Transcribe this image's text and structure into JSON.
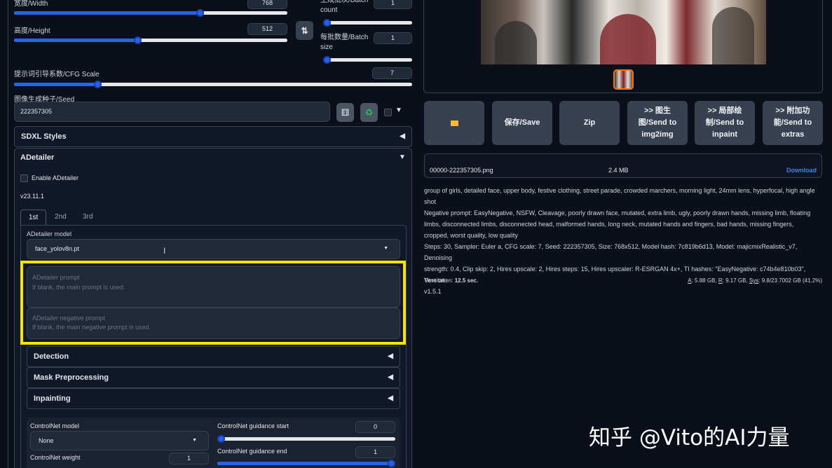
{
  "sliders": {
    "width": {
      "label": "宽度/Width",
      "value": "768",
      "fill": 0.68
    },
    "height": {
      "label": "高度/Height",
      "value": "512",
      "fill": 0.45
    },
    "batch_count": {
      "label1": "生成批次/Batch",
      "label2": "count",
      "value": "1",
      "fill": 0.0
    },
    "batch_size": {
      "label1": "每批数量/Batch",
      "label2": "size",
      "value": "1",
      "fill": 0.0
    },
    "cfg": {
      "label": "提示词引导系数/CFG Scale",
      "value": "7",
      "fill": 0.21
    }
  },
  "seed": {
    "label": "图像生成种子/Seed",
    "value": "222357305"
  },
  "sdxl_styles": {
    "title": "SDXL Styles"
  },
  "adetailer": {
    "title": "ADetailer",
    "enable_label": "Enable ADetailer",
    "version": "v23.11.1",
    "tabs": [
      "1st",
      "2nd",
      "3rd"
    ],
    "model_label": "ADetailer model",
    "model_value": "face_yolov8n.pt",
    "prompt_label": "ADetailer prompt",
    "prompt_placeholder": "If blank, the main prompt is used.",
    "neg_label": "ADetailer negative prompt",
    "neg_placeholder": "If blank, the main negative prompt is used.",
    "sections": [
      "Detection",
      "Mask Preprocessing",
      "Inpainting"
    ],
    "controlnet": {
      "model_label": "ControlNet model",
      "model_value": "None",
      "weight_label": "ControlNet weight",
      "weight_value": "1",
      "start_label": "ControlNet guidance start",
      "start_value": "0",
      "end_label": "ControlNet guidance end",
      "end_value": "1"
    }
  },
  "output_buttons": {
    "folder_icon": "folder-icon",
    "save": "保存/Save",
    "zip": "Zip",
    "img2img": [
      ">> 图生",
      "图/Send to",
      "img2img"
    ],
    "inpaint": [
      ">> 局部绘",
      "制/Send to",
      "inpaint"
    ],
    "extras": [
      ">> 附加功",
      "能/Send to",
      "extras"
    ]
  },
  "file": {
    "name": "00000-222357305.png",
    "size": "2.4 MB",
    "download": "Download"
  },
  "generation_info": {
    "prompt": [
      "group of girls, detailed face, upper body, festive clothing, street parade, crowded marchers, morning light, 24mm lens, hyperfocal, high angle",
      "shot"
    ],
    "negative": [
      "Negative prompt: EasyNegative, NSFW, Cleavage, poorly drawn face, mutated, extra limb, ugly, poorly drawn hands, missing limb, floating",
      "limbs, disconnected limbs, disconnected head, malformed hands, long neck, mutated hands and fingers, bad hands, missing fingers,",
      "cropped, worst quality, low quality"
    ],
    "params": [
      "Steps: 30, Sampler: Euler a, CFG scale: 7, Seed: 222357305, Size: 768x512, Model hash: 7c819b6d13, Model: majicmixRealistic_v7, Denoising",
      "strength: 0.4, Clip skip: 2, Hires upscale: 2, Hires steps: 15, Hires upscaler: R-ESRGAN 4x+, TI hashes: \"EasyNegative: c74b4e810b03\", Version:",
      "v1.5.1"
    ],
    "time_label": "Time taken:",
    "time_value": "12.5 sec.",
    "mem": {
      "a_label": "A",
      "a_value": ": 5.88 GB,",
      "r_label": "R",
      "r_value": ": 9.17 GB,",
      "sys_label": "Sys",
      "sys_value": ": 9.8/23.7002 GB (41.2%)"
    }
  },
  "watermark": "知乎 @Vito的AI力量",
  "colors": {
    "accent": "#2563eb",
    "highlight": "#f5e300",
    "background": "#0b0f19"
  }
}
